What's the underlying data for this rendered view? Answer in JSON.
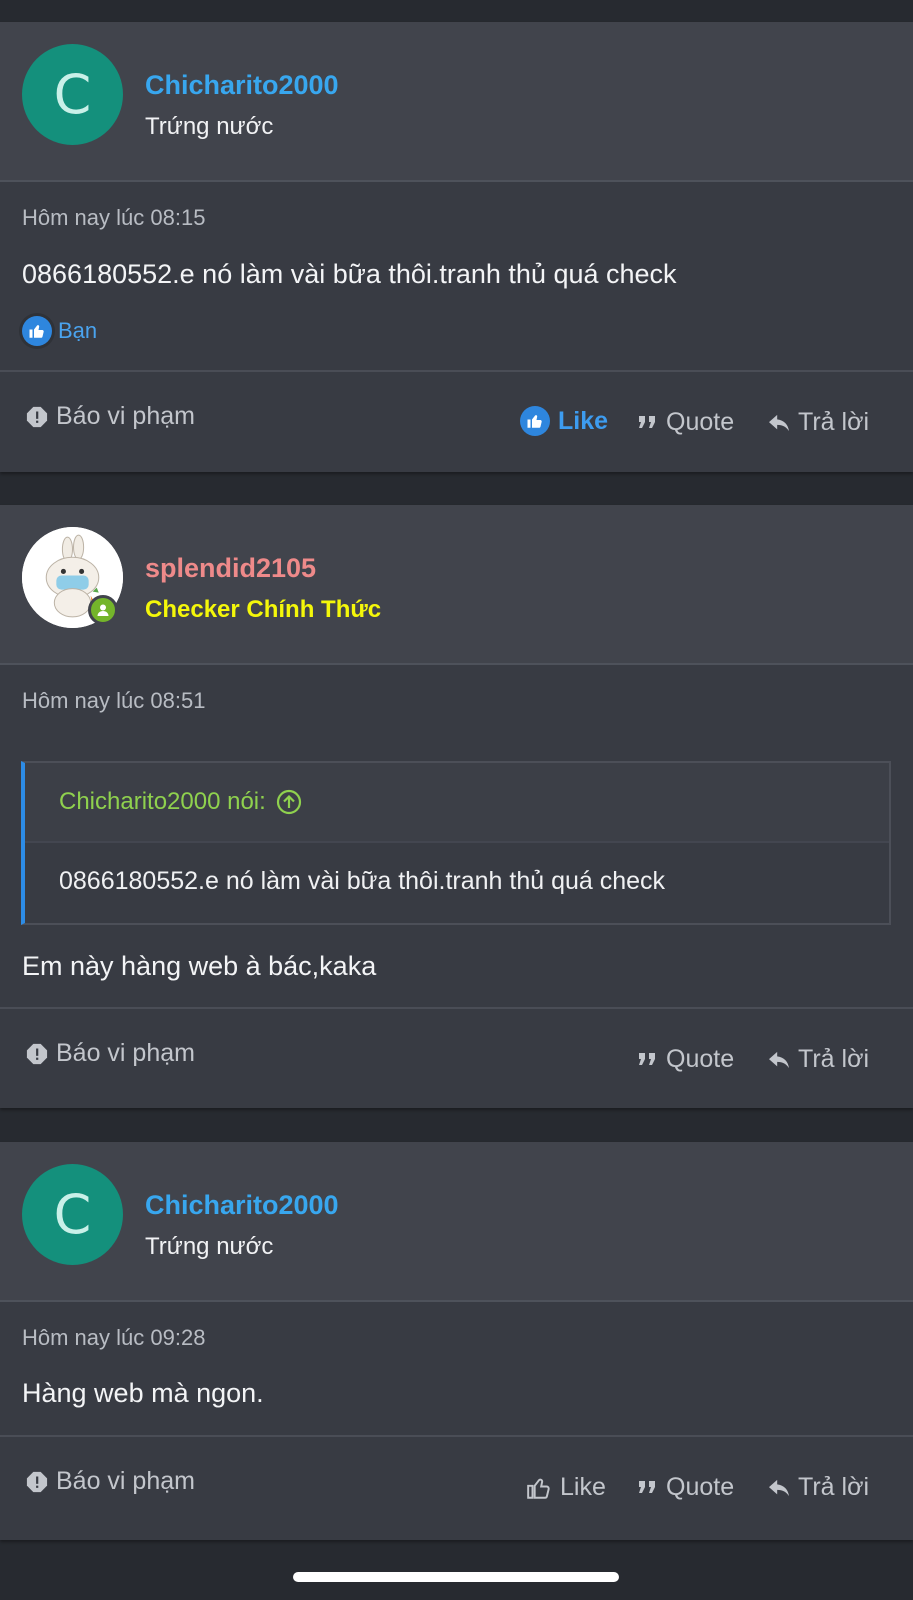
{
  "posts": [
    {
      "username": "Chicharito2000",
      "username_color": "#38a7ef",
      "user_title": "Trứng nước",
      "avatar_letter": "C",
      "timestamp": "Hôm nay lúc 08:15",
      "message": "0866180552.e nó làm vài bữa thôi.tranh thủ quá check",
      "reaction_label": "Bạn",
      "footer": {
        "report": "Báo vi phạm",
        "like": "Like",
        "quote": "Quote",
        "reply": "Trả lời"
      }
    },
    {
      "username": "splendid2105",
      "username_color": "#ee8a8a",
      "user_title": "Checker Chính Thức",
      "avatar_description": "bunny-with-mask-avatar",
      "timestamp": "Hôm nay lúc 08:51",
      "quote_author": "Chicharito2000 nói:",
      "quote_text": "0866180552.e nó làm vài bữa thôi.tranh thủ quá check",
      "message": "Em này hàng web à bác,kaka",
      "footer": {
        "report": "Báo vi phạm",
        "quote": "Quote",
        "reply": "Trả lời"
      }
    },
    {
      "username": "Chicharito2000",
      "username_color": "#38a7ef",
      "user_title": "Trứng nước",
      "avatar_letter": "C",
      "timestamp": "Hôm nay lúc 09:28",
      "message": "Hàng web mà ngon.",
      "footer": {
        "report": "Báo vi phạm",
        "like": "Like",
        "quote": "Quote",
        "reply": "Trả lời"
      }
    }
  ],
  "colors": {
    "background": "#272a30",
    "post_bg": "#383b43",
    "header_bg": "#41444c",
    "accent_blue": "#3d9cf0",
    "quote_green": "#8fd14e",
    "special_title": "#f4f70a",
    "online_green": "#74b52b"
  }
}
